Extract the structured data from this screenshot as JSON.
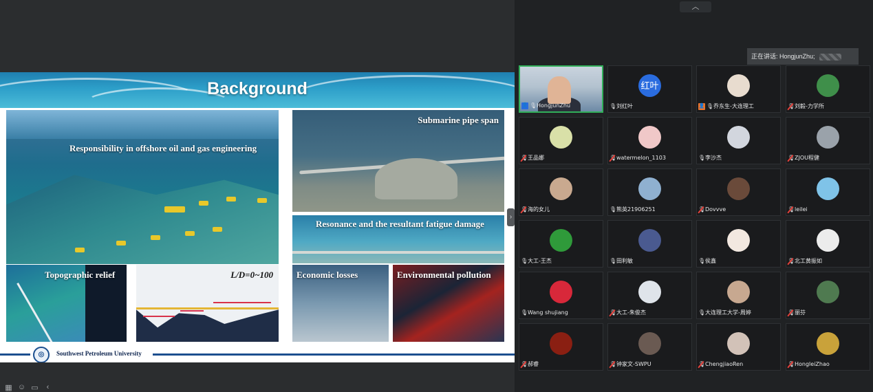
{
  "slide": {
    "title": "Background",
    "captions": {
      "offshore": "Responsibility in offshore oil and gas engineering",
      "pipespan": "Submarine pipe span",
      "resonance": "Resonance and the resultant fatigue damage",
      "topo": "Topographic relief",
      "ld": "L/D=0~100",
      "econ": "Economic losses",
      "env": "Environmental pollution"
    },
    "footer_university": "Southwest Petroleum University"
  },
  "gallery": {
    "current_speaker": "正在讲话: HongjunZhu;",
    "participants": [
      {
        "name": "HongjunZhu",
        "avatar": "",
        "muted": false,
        "badge": "host",
        "video": true
      },
      {
        "name": "刘红叶",
        "avatar": "红叶",
        "muted": false,
        "badge": "",
        "color": "#2a6cdf"
      },
      {
        "name": "乔东生-大连理工",
        "avatar": "",
        "muted": false,
        "badge": "cohost",
        "color": "#e8dccf"
      },
      {
        "name": "刘毅-力学所",
        "avatar": "",
        "muted": true,
        "badge": "",
        "color": "#3f8f4a"
      },
      {
        "name": "王品娜",
        "avatar": "",
        "muted": true,
        "badge": "",
        "color": "#d9e0a8"
      },
      {
        "name": "watermelon_1103",
        "avatar": "",
        "muted": true,
        "badge": "",
        "color": "#f0c8c8"
      },
      {
        "name": "李沙杰",
        "avatar": "",
        "muted": false,
        "badge": "",
        "color": "#d2d6de"
      },
      {
        "name": "ZJOU程健",
        "avatar": "",
        "muted": true,
        "badge": "",
        "color": "#9aa2aa"
      },
      {
        "name": "海的女儿",
        "avatar": "",
        "muted": true,
        "badge": "",
        "color": "#c9a98f"
      },
      {
        "name": "熊英21906251",
        "avatar": "",
        "muted": false,
        "badge": "",
        "color": "#8fb0d0"
      },
      {
        "name": "Dovvve",
        "avatar": "",
        "muted": true,
        "badge": "",
        "color": "#6a4a3a"
      },
      {
        "name": "leilei",
        "avatar": "",
        "muted": true,
        "badge": "",
        "color": "#7fc3e8"
      },
      {
        "name": "大工-王杰",
        "avatar": "",
        "muted": false,
        "badge": "",
        "color": "#2f9a3a"
      },
      {
        "name": "田利敏",
        "avatar": "",
        "muted": false,
        "badge": "",
        "color": "#4a5a90"
      },
      {
        "name": "侯鑫",
        "avatar": "",
        "muted": false,
        "badge": "",
        "color": "#f2e8e0"
      },
      {
        "name": "北工黄振如",
        "avatar": "",
        "muted": true,
        "badge": "",
        "color": "#ececec"
      },
      {
        "name": "Wang shujiang",
        "avatar": "",
        "muted": false,
        "badge": "",
        "color": "#d8283a"
      },
      {
        "name": "大工-朱俊杰",
        "avatar": "",
        "muted": true,
        "badge": "",
        "color": "#dfe4ea"
      },
      {
        "name": "大连理工大学-周婷",
        "avatar": "",
        "muted": false,
        "badge": "",
        "color": "#c7a890"
      },
      {
        "name": "丽芬",
        "avatar": "",
        "muted": true,
        "badge": "",
        "color": "#4f7a50"
      },
      {
        "name": "郝睿",
        "avatar": "",
        "muted": true,
        "badge": "",
        "color": "#8a1f12"
      },
      {
        "name": "钟家文-SWPU",
        "avatar": "",
        "muted": true,
        "badge": "",
        "color": "#6a5a52"
      },
      {
        "name": "ChengjiaoRen",
        "avatar": "",
        "muted": true,
        "badge": "",
        "color": "#d2c2b8"
      },
      {
        "name": "HongleiZhao",
        "avatar": "",
        "muted": true,
        "badge": "",
        "color": "#c9a23a"
      }
    ]
  },
  "colors": {
    "active_border": "#31b05a",
    "muted_red": "#e5413b",
    "slide_accent": "#1c4f8f"
  },
  "icons": [
    "chevron-up-icon",
    "chevron-left-icon",
    "microphone-icon",
    "microphone-muted-icon",
    "person-icon"
  ]
}
